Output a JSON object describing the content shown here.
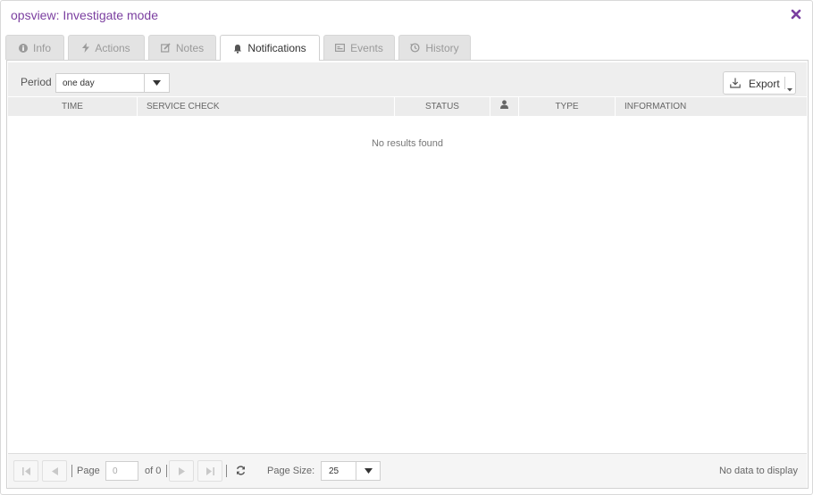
{
  "window": {
    "title": "opsview: Investigate mode",
    "close_icon": "close-icon",
    "accent": "#7b3fa0"
  },
  "tabs": [
    {
      "label": "Info",
      "icon": "info-icon",
      "active": false
    },
    {
      "label": "Actions",
      "icon": "bolt-icon",
      "active": false
    },
    {
      "label": "Notes",
      "icon": "edit-icon",
      "active": false
    },
    {
      "label": "Notifications",
      "icon": "bell-icon",
      "active": true
    },
    {
      "label": "Events",
      "icon": "events-icon",
      "active": false
    },
    {
      "label": "History",
      "icon": "history-icon",
      "active": false
    }
  ],
  "toolbar": {
    "period_label": "Period",
    "period_value": "one day",
    "export_label": "Export"
  },
  "table": {
    "columns": [
      "TIME",
      "SERVICE CHECK",
      "STATUS",
      "",
      "TYPE",
      "INFORMATION"
    ],
    "user_column_icon": "user-icon",
    "empty_message": "No results found",
    "rows": []
  },
  "pager": {
    "page_label": "Page",
    "page_value": "0",
    "of_label": "of 0",
    "page_size_label": "Page Size:",
    "page_size_value": "25",
    "status": "No data to display"
  }
}
